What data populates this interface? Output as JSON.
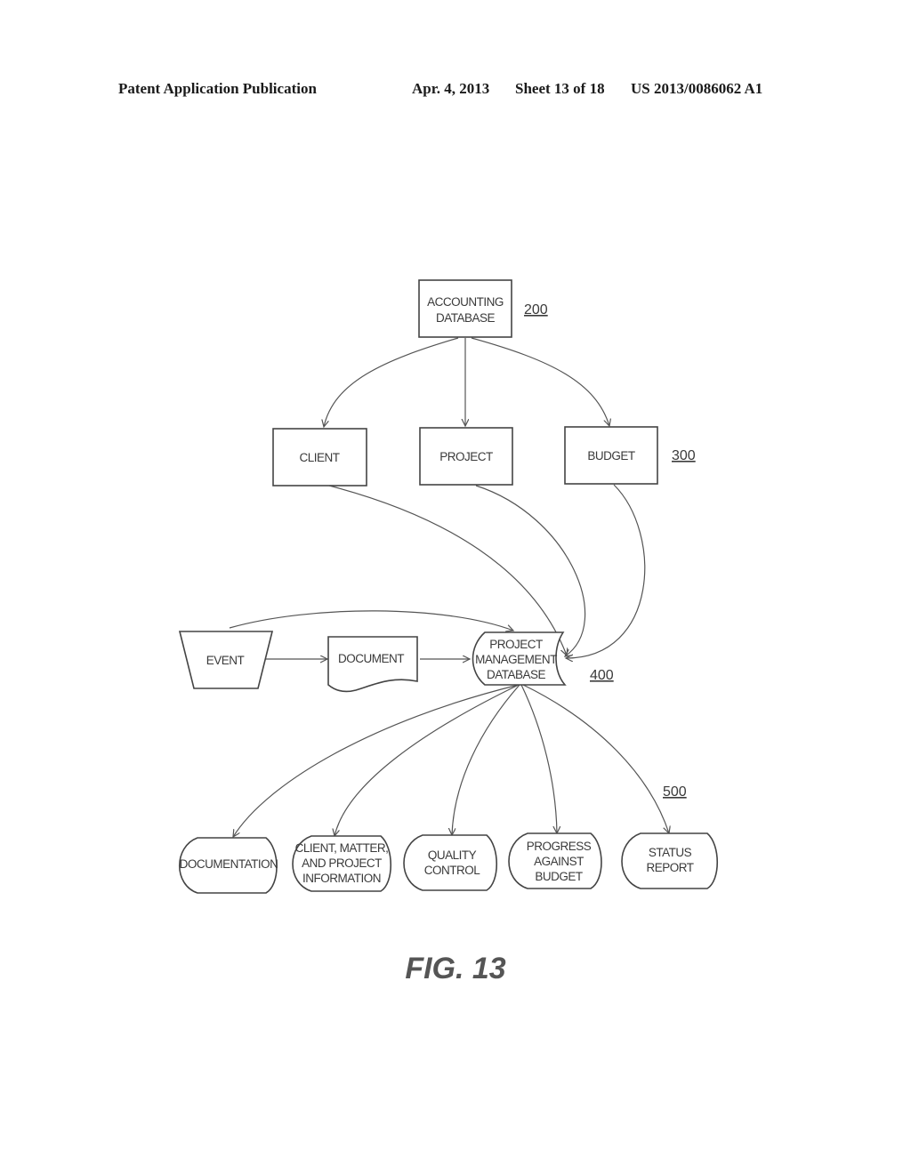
{
  "header": {
    "publication": "Patent Application Publication",
    "date": "Apr. 4, 2013",
    "sheet": "Sheet 13 of 18",
    "number": "US 2013/0086062 A1"
  },
  "nodes": {
    "accounting_db": {
      "lines": [
        "ACCOUNTING",
        "DATABASE"
      ],
      "shape": "rectangle"
    },
    "client": {
      "lines": [
        "CLIENT"
      ],
      "shape": "rectangle"
    },
    "project": {
      "lines": [
        "PROJECT"
      ],
      "shape": "rectangle"
    },
    "budget": {
      "lines": [
        "BUDGET"
      ],
      "shape": "rectangle"
    },
    "event": {
      "lines": [
        "EVENT"
      ],
      "shape": "manual-operation"
    },
    "document": {
      "lines": [
        "DOCUMENT"
      ],
      "shape": "document"
    },
    "pm_db": {
      "lines": [
        "PROJECT",
        "MANAGEMENT",
        "DATABASE"
      ],
      "shape": "stored-data"
    },
    "documentation": {
      "lines": [
        "DOCUMENTATION"
      ],
      "shape": "display"
    },
    "client_matter": {
      "lines": [
        "CLIENT, MATTER,",
        "AND PROJECT",
        "INFORMATION"
      ],
      "shape": "display"
    },
    "quality": {
      "lines": [
        "QUALITY",
        "CONTROL"
      ],
      "shape": "display"
    },
    "progress": {
      "lines": [
        "PROGRESS",
        "AGAINST",
        "BUDGET"
      ],
      "shape": "display"
    },
    "status": {
      "lines": [
        "STATUS",
        "REPORT"
      ],
      "shape": "display"
    }
  },
  "edges": [
    {
      "from": "accounting_db",
      "to": "client"
    },
    {
      "from": "accounting_db",
      "to": "project"
    },
    {
      "from": "accounting_db",
      "to": "budget"
    },
    {
      "from": "client",
      "to": "pm_db"
    },
    {
      "from": "project",
      "to": "pm_db"
    },
    {
      "from": "budget",
      "to": "pm_db"
    },
    {
      "from": "event",
      "to": "pm_db"
    },
    {
      "from": "event",
      "to": "document"
    },
    {
      "from": "document",
      "to": "pm_db"
    },
    {
      "from": "pm_db",
      "to": "documentation"
    },
    {
      "from": "pm_db",
      "to": "client_matter"
    },
    {
      "from": "pm_db",
      "to": "quality"
    },
    {
      "from": "pm_db",
      "to": "progress"
    },
    {
      "from": "pm_db",
      "to": "status"
    }
  ],
  "refs": {
    "r200": "200",
    "r300": "300",
    "r400": "400",
    "r500": "500"
  },
  "figure_label": "FIG. 13"
}
